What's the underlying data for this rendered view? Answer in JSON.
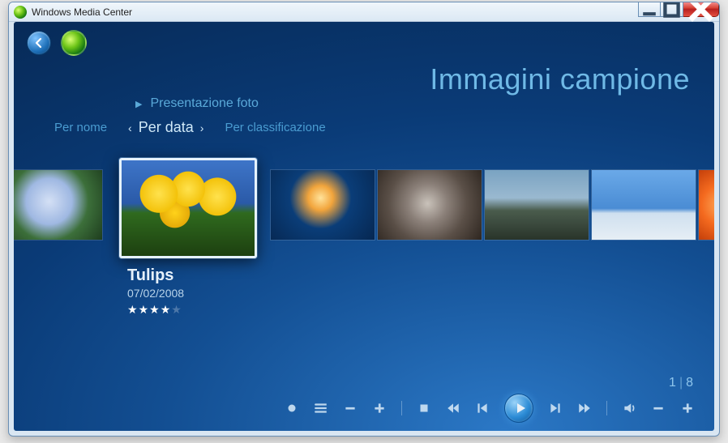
{
  "window": {
    "title": "Windows Media Center"
  },
  "header": {
    "page_title": "Immagini campione"
  },
  "slideshow": {
    "label": "Presentazione foto"
  },
  "sort": {
    "by_name": "Per nome",
    "by_date": "Per data",
    "by_rating": "Per classificazione",
    "active": "by_date"
  },
  "selected": {
    "title": "Tulips",
    "date": "07/02/2008",
    "rating": 4,
    "rating_max": 5
  },
  "thumbs": [
    {
      "name": "Hydrangeas"
    },
    {
      "name": "Tulips"
    },
    {
      "name": "Jellyfish"
    },
    {
      "name": "Koala"
    },
    {
      "name": "Lighthouse"
    },
    {
      "name": "Penguins"
    },
    {
      "name": "Chrysanthemum"
    }
  ],
  "counter": {
    "index": "1",
    "total": "8",
    "sep": "|"
  },
  "transport": {
    "record": "record",
    "guide": "guide",
    "ch_down": "channel-down",
    "ch_up": "channel-up",
    "stop": "stop",
    "rewind": "rewind",
    "prev": "previous",
    "play": "play",
    "next": "next",
    "fwd": "fast-forward",
    "mute": "mute",
    "vol_down": "volume-down",
    "vol_up": "volume-up"
  }
}
